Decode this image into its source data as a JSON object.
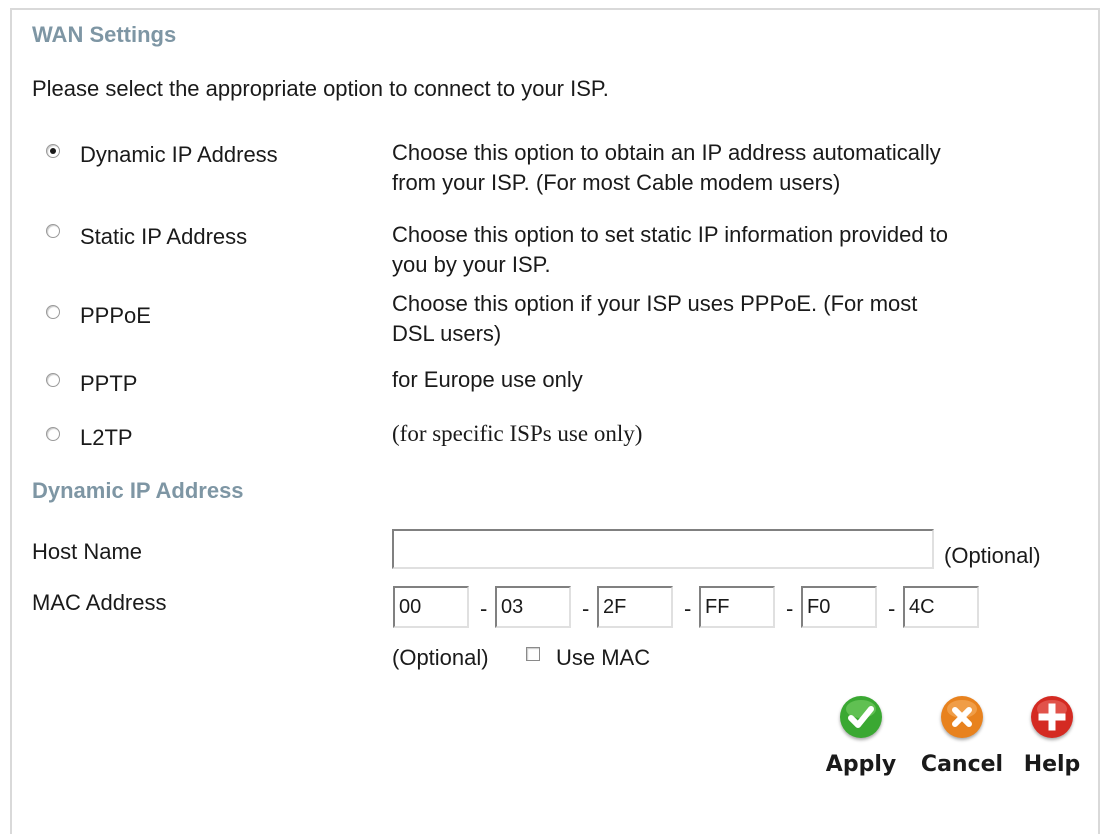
{
  "section_title": "WAN Settings",
  "intro": "Please select the appropriate option to connect to your ISP.",
  "options": [
    {
      "label": "Dynamic IP Address",
      "selected": true,
      "desc_line1": "Choose this option to obtain an IP address automatically",
      "desc_line2": "from your ISP. (For most Cable modem users)"
    },
    {
      "label": "Static IP Address",
      "selected": false,
      "desc_line1": "Choose this option to set static IP information provided to",
      "desc_line2": "you by your ISP."
    },
    {
      "label": "PPPoE",
      "selected": false,
      "desc_line1": "Choose this option if your ISP uses PPPoE. (For most",
      "desc_line2": "DSL users)"
    },
    {
      "label": "PPTP",
      "selected": false,
      "desc_line1": "for Europe use only",
      "desc_line2": ""
    },
    {
      "label": "L2TP",
      "selected": false,
      "desc_line1": "(for specific ISPs use only)",
      "desc_line2": ""
    }
  ],
  "dynamic_section_title": "Dynamic IP Address",
  "host_name": {
    "label": "Host Name",
    "value": "",
    "optional": "(Optional)"
  },
  "mac_address": {
    "label": "MAC Address",
    "octets": [
      "00",
      "03",
      "2F",
      "FF",
      "F0",
      "4C"
    ],
    "separator": "-",
    "optional": "(Optional)",
    "use_mac_label": "Use MAC",
    "use_mac_checked": false
  },
  "buttons": {
    "apply": {
      "label": "Apply",
      "color": "#3aa832",
      "icon": "checkmark-icon"
    },
    "cancel": {
      "label": "Cancel",
      "color": "#e8821e",
      "icon": "x-icon"
    },
    "help": {
      "label": "Help",
      "color": "#d42a22",
      "icon": "plus-icon"
    }
  }
}
